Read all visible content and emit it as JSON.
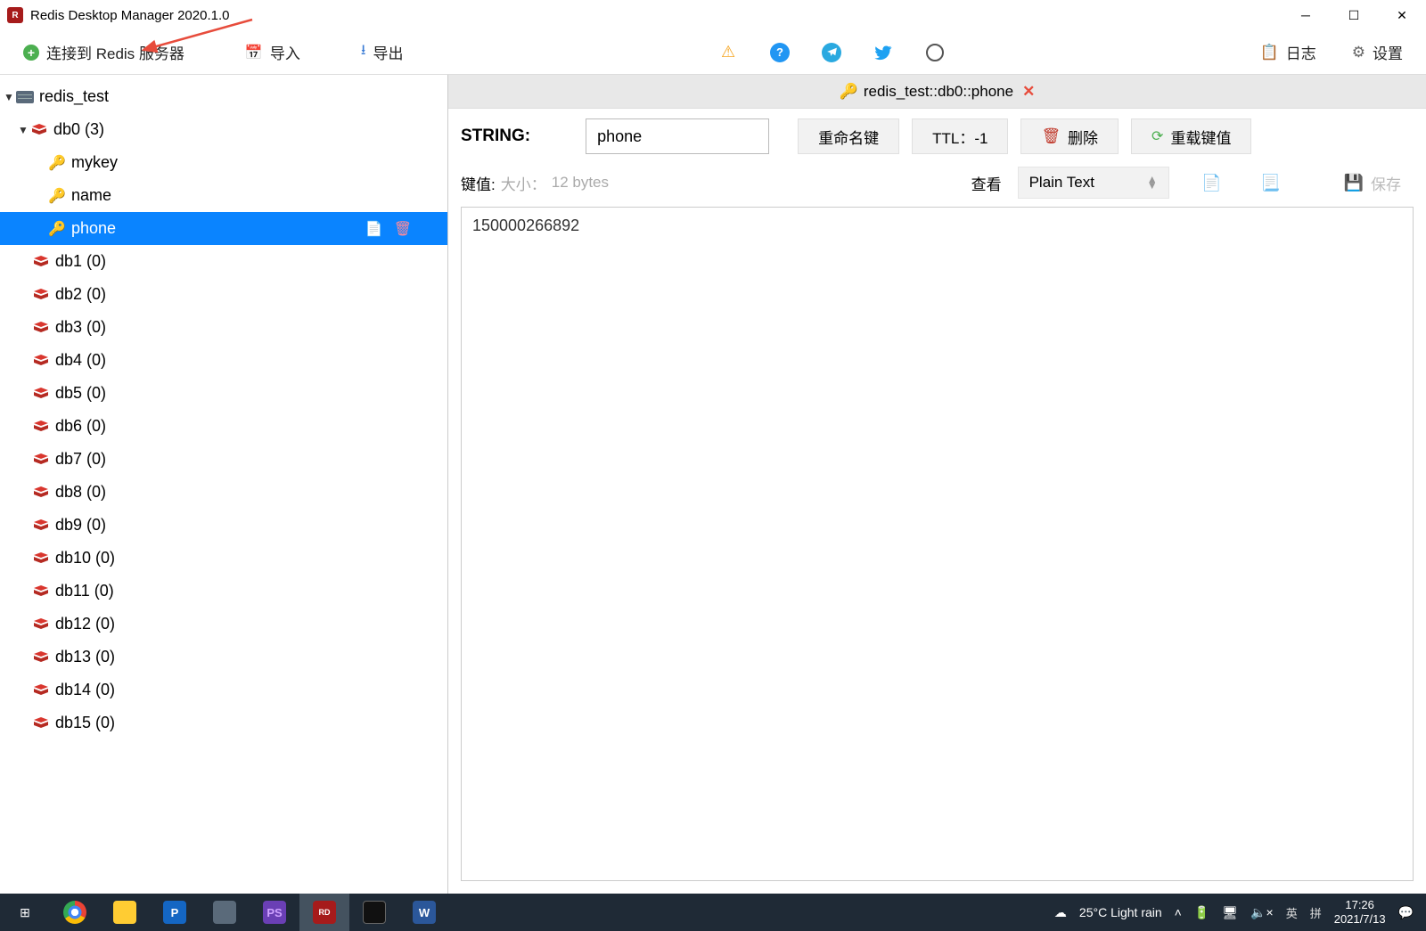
{
  "title": "Redis Desktop Manager 2020.1.0",
  "toolbar": {
    "connect": "连接到 Redis 服务器",
    "import": "导入",
    "export": "导出",
    "log": "日志",
    "settings": "设置"
  },
  "tree": {
    "connection": "redis_test",
    "db0": {
      "label": "db0  (3)"
    },
    "keys": [
      "mykey",
      "name",
      "phone"
    ],
    "selectedKey": "phone",
    "dbs": [
      "db1  (0)",
      "db2  (0)",
      "db3  (0)",
      "db4  (0)",
      "db5  (0)",
      "db6  (0)",
      "db7  (0)",
      "db8  (0)",
      "db9  (0)",
      "db10  (0)",
      "db11  (0)",
      "db12  (0)",
      "db13  (0)",
      "db14  (0)",
      "db15  (0)"
    ]
  },
  "tab": {
    "title": "redis_test::db0::phone"
  },
  "detail": {
    "typeLabel": "STRING:",
    "keyName": "phone",
    "rename": "重命名键",
    "ttl": "TTL：-1",
    "delete": "删除",
    "reload": "重载键值",
    "valueLabel": "键值:",
    "sizeLabel": "大小：",
    "size": "12 bytes",
    "viewLabel": "查看",
    "format": "Plain Text",
    "save": "保存",
    "value": "150000266892"
  },
  "taskbar": {
    "weather": "25°C  Light rain",
    "ime1": "英",
    "ime2": "拼",
    "time": "17:26",
    "date": "2021/7/13"
  }
}
